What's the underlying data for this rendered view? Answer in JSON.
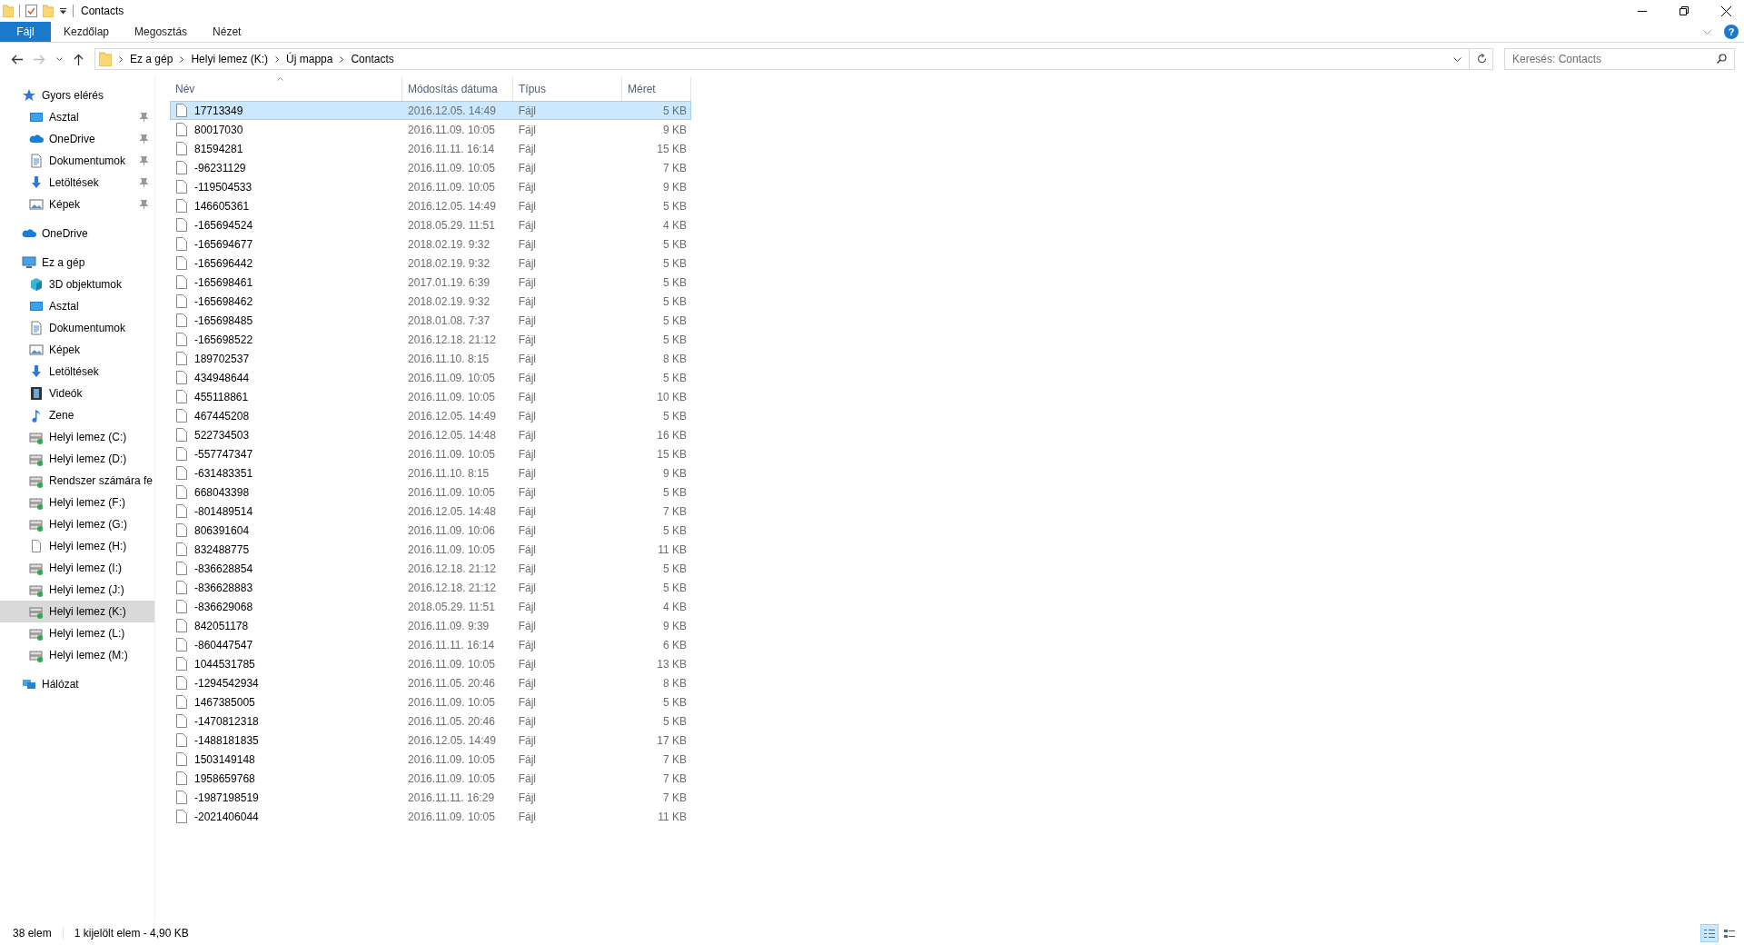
{
  "window": {
    "title": "Contacts"
  },
  "ribbon_tabs": [
    {
      "label": "Fájl",
      "kind": "file"
    },
    {
      "label": "Kezdőlap",
      "kind": "tab"
    },
    {
      "label": "Megosztás",
      "kind": "tab"
    },
    {
      "label": "Nézet",
      "kind": "tab"
    }
  ],
  "help_button": {
    "label": "?"
  },
  "breadcrumb": [
    "Ez a gép",
    "Helyi lemez (K:)",
    "Új mappa",
    "Contacts"
  ],
  "search": {
    "placeholder": "Keresés: Contacts"
  },
  "sidebar": {
    "items": [
      {
        "label": "Gyors elérés",
        "kind": "star",
        "selected": false,
        "children": [
          {
            "label": "Asztal",
            "kind": "desktop",
            "pinned": true,
            "selected": false
          },
          {
            "label": "OneDrive",
            "kind": "cloud",
            "pinned": true,
            "selected": false
          },
          {
            "label": "Dokumentumok",
            "kind": "doc",
            "pinned": true,
            "selected": false
          },
          {
            "label": "Letöltések",
            "kind": "download",
            "pinned": true,
            "selected": false
          },
          {
            "label": "Képek",
            "kind": "pictures",
            "pinned": true,
            "selected": false
          }
        ]
      },
      {
        "label": "OneDrive",
        "kind": "cloud",
        "selected": false
      },
      {
        "label": "Ez a gép",
        "kind": "monitor",
        "selected": false,
        "children": [
          {
            "label": "3D objektumok",
            "kind": "cube",
            "selected": false
          },
          {
            "label": "Asztal",
            "kind": "desktop",
            "selected": false
          },
          {
            "label": "Dokumentumok",
            "kind": "doc",
            "selected": false
          },
          {
            "label": "Képek",
            "kind": "pictures",
            "selected": false
          },
          {
            "label": "Letöltések",
            "kind": "download",
            "selected": false
          },
          {
            "label": "Videók",
            "kind": "video",
            "selected": false
          },
          {
            "label": "Zene",
            "kind": "music",
            "selected": false
          },
          {
            "label": "Helyi lemez (C:)",
            "kind": "drive",
            "selected": false
          },
          {
            "label": "Helyi lemez (D:)",
            "kind": "drive",
            "selected": false
          },
          {
            "label": "Rendszer számára fe",
            "kind": "drive",
            "selected": false
          },
          {
            "label": "Helyi lemez (F:)",
            "kind": "drive",
            "selected": false
          },
          {
            "label": "Helyi lemez (G:)",
            "kind": "drive",
            "selected": false
          },
          {
            "label": "Helyi lemez (H:)",
            "kind": "file",
            "selected": false
          },
          {
            "label": "Helyi lemez (I:)",
            "kind": "drive",
            "selected": false
          },
          {
            "label": "Helyi lemez (J:)",
            "kind": "drive",
            "selected": false
          },
          {
            "label": "Helyi lemez (K:)",
            "kind": "drive",
            "selected": true
          },
          {
            "label": "Helyi lemez (L:)",
            "kind": "drive",
            "selected": false
          },
          {
            "label": "Helyi lemez (M:)",
            "kind": "drive",
            "selected": false
          }
        ]
      },
      {
        "label": "Hálózat",
        "kind": "network",
        "selected": false
      }
    ]
  },
  "table": {
    "columns": [
      {
        "label": "Név",
        "sorted": true
      },
      {
        "label": "Módosítás dátuma",
        "sorted": false
      },
      {
        "label": "Típus",
        "sorted": false
      },
      {
        "label": "Méret",
        "sorted": false
      }
    ],
    "rows": [
      {
        "name": "17713349",
        "date": "2016.12.05. 14:49",
        "type": "Fájl",
        "size": "5 KB",
        "selected": true
      },
      {
        "name": "80017030",
        "date": "2016.11.09. 10:05",
        "type": "Fájl",
        "size": "9 KB",
        "selected": false
      },
      {
        "name": "81594281",
        "date": "2016.11.11. 16:14",
        "type": "Fájl",
        "size": "15 KB",
        "selected": false
      },
      {
        "name": "-96231129",
        "date": "2016.11.09. 10:05",
        "type": "Fájl",
        "size": "7 KB",
        "selected": false
      },
      {
        "name": "-119504533",
        "date": "2016.11.09. 10:05",
        "type": "Fájl",
        "size": "9 KB",
        "selected": false
      },
      {
        "name": "146605361",
        "date": "2016.12.05. 14:49",
        "type": "Fájl",
        "size": "5 KB",
        "selected": false
      },
      {
        "name": "-165694524",
        "date": "2018.05.29. 11:51",
        "type": "Fájl",
        "size": "4 KB",
        "selected": false
      },
      {
        "name": "-165694677",
        "date": "2018.02.19. 9:32",
        "type": "Fájl",
        "size": "5 KB",
        "selected": false
      },
      {
        "name": "-165696442",
        "date": "2018.02.19. 9:32",
        "type": "Fájl",
        "size": "5 KB",
        "selected": false
      },
      {
        "name": "-165698461",
        "date": "2017.01.19. 6:39",
        "type": "Fájl",
        "size": "5 KB",
        "selected": false
      },
      {
        "name": "-165698462",
        "date": "2018.02.19. 9:32",
        "type": "Fájl",
        "size": "5 KB",
        "selected": false
      },
      {
        "name": "-165698485",
        "date": "2018.01.08. 7:37",
        "type": "Fájl",
        "size": "5 KB",
        "selected": false
      },
      {
        "name": "-165698522",
        "date": "2016.12.18. 21:12",
        "type": "Fájl",
        "size": "5 KB",
        "selected": false
      },
      {
        "name": "189702537",
        "date": "2016.11.10. 8:15",
        "type": "Fájl",
        "size": "8 KB",
        "selected": false
      },
      {
        "name": "434948644",
        "date": "2016.11.09. 10:05",
        "type": "Fájl",
        "size": "5 KB",
        "selected": false
      },
      {
        "name": "455118861",
        "date": "2016.11.09. 10:05",
        "type": "Fájl",
        "size": "10 KB",
        "selected": false
      },
      {
        "name": "467445208",
        "date": "2016.12.05. 14:49",
        "type": "Fájl",
        "size": "5 KB",
        "selected": false
      },
      {
        "name": "522734503",
        "date": "2016.12.05. 14:48",
        "type": "Fájl",
        "size": "16 KB",
        "selected": false
      },
      {
        "name": "-557747347",
        "date": "2016.11.09. 10:05",
        "type": "Fájl",
        "size": "15 KB",
        "selected": false
      },
      {
        "name": "-631483351",
        "date": "2016.11.10. 8:15",
        "type": "Fájl",
        "size": "9 KB",
        "selected": false
      },
      {
        "name": "668043398",
        "date": "2016.11.09. 10:05",
        "type": "Fájl",
        "size": "5 KB",
        "selected": false
      },
      {
        "name": "-801489514",
        "date": "2016.12.05. 14:48",
        "type": "Fájl",
        "size": "7 KB",
        "selected": false
      },
      {
        "name": "806391604",
        "date": "2016.11.09. 10:06",
        "type": "Fájl",
        "size": "5 KB",
        "selected": false
      },
      {
        "name": "832488775",
        "date": "2016.11.09. 10:05",
        "type": "Fájl",
        "size": "11 KB",
        "selected": false
      },
      {
        "name": "-836628854",
        "date": "2016.12.18. 21:12",
        "type": "Fájl",
        "size": "5 KB",
        "selected": false
      },
      {
        "name": "-836628883",
        "date": "2016.12.18. 21:12",
        "type": "Fájl",
        "size": "5 KB",
        "selected": false
      },
      {
        "name": "-836629068",
        "date": "2018.05.29. 11:51",
        "type": "Fájl",
        "size": "4 KB",
        "selected": false
      },
      {
        "name": "842051178",
        "date": "2016.11.09. 9:39",
        "type": "Fájl",
        "size": "9 KB",
        "selected": false
      },
      {
        "name": "-860447547",
        "date": "2016.11.11. 16:14",
        "type": "Fájl",
        "size": "6 KB",
        "selected": false
      },
      {
        "name": "1044531785",
        "date": "2016.11.09. 10:05",
        "type": "Fájl",
        "size": "13 KB",
        "selected": false
      },
      {
        "name": "-1294542934",
        "date": "2016.11.05. 20:46",
        "type": "Fájl",
        "size": "8 KB",
        "selected": false
      },
      {
        "name": "1467385005",
        "date": "2016.11.09. 10:05",
        "type": "Fájl",
        "size": "5 KB",
        "selected": false
      },
      {
        "name": "-1470812318",
        "date": "2016.11.05. 20:46",
        "type": "Fájl",
        "size": "5 KB",
        "selected": false
      },
      {
        "name": "-1488181835",
        "date": "2016.12.05. 14:49",
        "type": "Fájl",
        "size": "17 KB",
        "selected": false
      },
      {
        "name": "1503149148",
        "date": "2016.11.09. 10:05",
        "type": "Fájl",
        "size": "7 KB",
        "selected": false
      },
      {
        "name": "1958659768",
        "date": "2016.11.09. 10:05",
        "type": "Fájl",
        "size": "7 KB",
        "selected": false
      },
      {
        "name": "-1987198519",
        "date": "2016.11.11. 16:29",
        "type": "Fájl",
        "size": "7 KB",
        "selected": false
      },
      {
        "name": "-2021406044",
        "date": "2016.11.09. 10:05",
        "type": "Fájl",
        "size": "11 KB",
        "selected": false
      }
    ]
  },
  "status_bar": {
    "item_count": "38 elem",
    "selection": "1 kijelölt elem - 4,90 KB",
    "views": [
      {
        "kind": "details",
        "selected": true
      },
      {
        "kind": "tiles",
        "selected": false
      }
    ]
  }
}
